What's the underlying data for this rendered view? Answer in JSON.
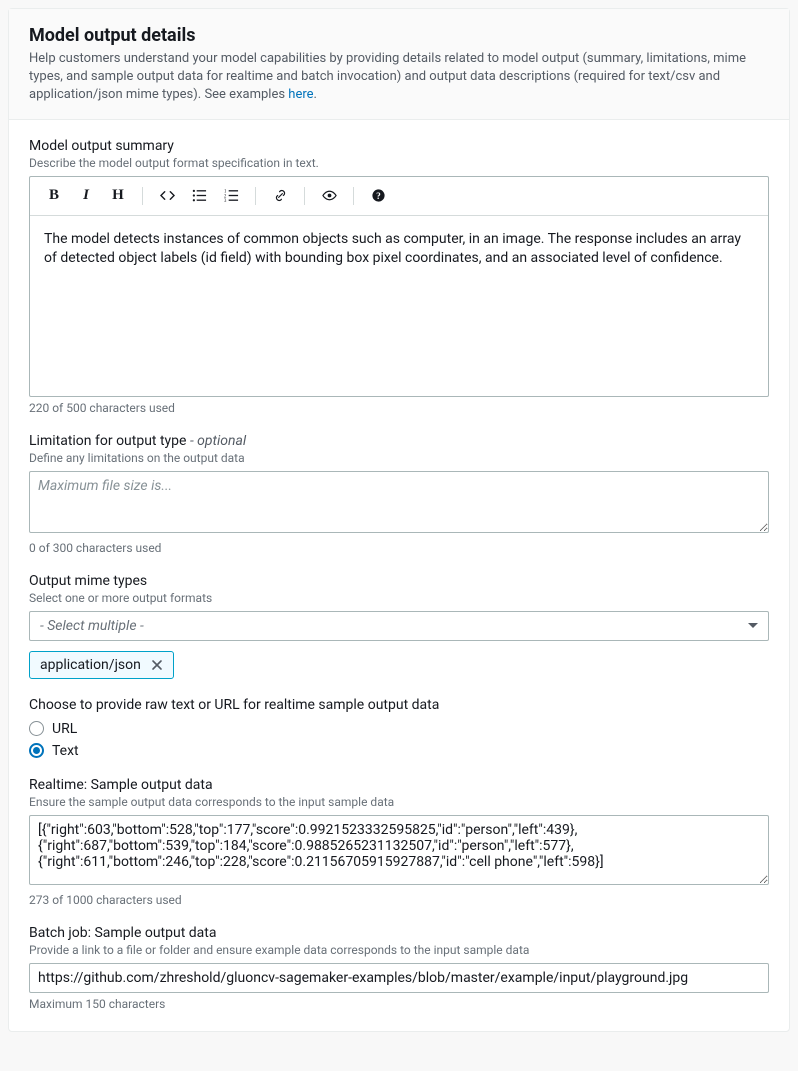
{
  "header": {
    "title": "Model output details",
    "description_pre": "Help customers understand your model capabilities by providing details related to model output (summary, limitations, mime types, and sample output data for realtime and batch invocation) and output data descriptions (required for text/csv and application/json mime types). See examples ",
    "link_text": "here",
    "description_post": "."
  },
  "summary": {
    "label": "Model output summary",
    "hint": "Describe the model output format specification in text.",
    "content": "The model detects instances of common objects such as computer, in an image. The response includes an array of detected object labels (id field) with bounding box pixel coordinates, and an associated level of confidence.",
    "char_count": "220 of 500 characters used",
    "toolbar": {
      "bold": "B",
      "italic": "I",
      "heading": "H"
    }
  },
  "limitation": {
    "label_main": "Limitation for output type ",
    "label_suffix": "- optional",
    "hint": "Define any limitations on the output data",
    "placeholder": "Maximum file size is...",
    "value": "",
    "char_count": "0 of 300 characters used"
  },
  "mime": {
    "label": "Output mime types",
    "hint": "Select one or more output formats",
    "placeholder": "- Select multiple -",
    "selected_tag": "application/json"
  },
  "sample_choice": {
    "label": "Choose to provide raw text or URL for realtime sample output data",
    "option_url": "URL",
    "option_text": "Text",
    "selected": "Text"
  },
  "realtime": {
    "label": "Realtime: Sample output data",
    "hint": "Ensure the sample output data corresponds to the input sample data",
    "value": "[{\"right\":603,\"bottom\":528,\"top\":177,\"score\":0.9921523332595825,\"id\":\"person\",\"left\":439},{\"right\":687,\"bottom\":539,\"top\":184,\"score\":0.9885265231132507,\"id\":\"person\",\"left\":577},{\"right\":611,\"bottom\":246,\"top\":228,\"score\":0.21156705915927887,\"id\":\"cell phone\",\"left\":598}]",
    "char_count": "273 of 1000 characters used"
  },
  "batch": {
    "label": "Batch job: Sample output data",
    "hint": "Provide a link to a file or folder and ensure example data corresponds to the input sample data",
    "value": "https://github.com/zhreshold/gluoncv-sagemaker-examples/blob/master/example/input/playground.jpg",
    "char_count": "Maximum 150 characters"
  }
}
